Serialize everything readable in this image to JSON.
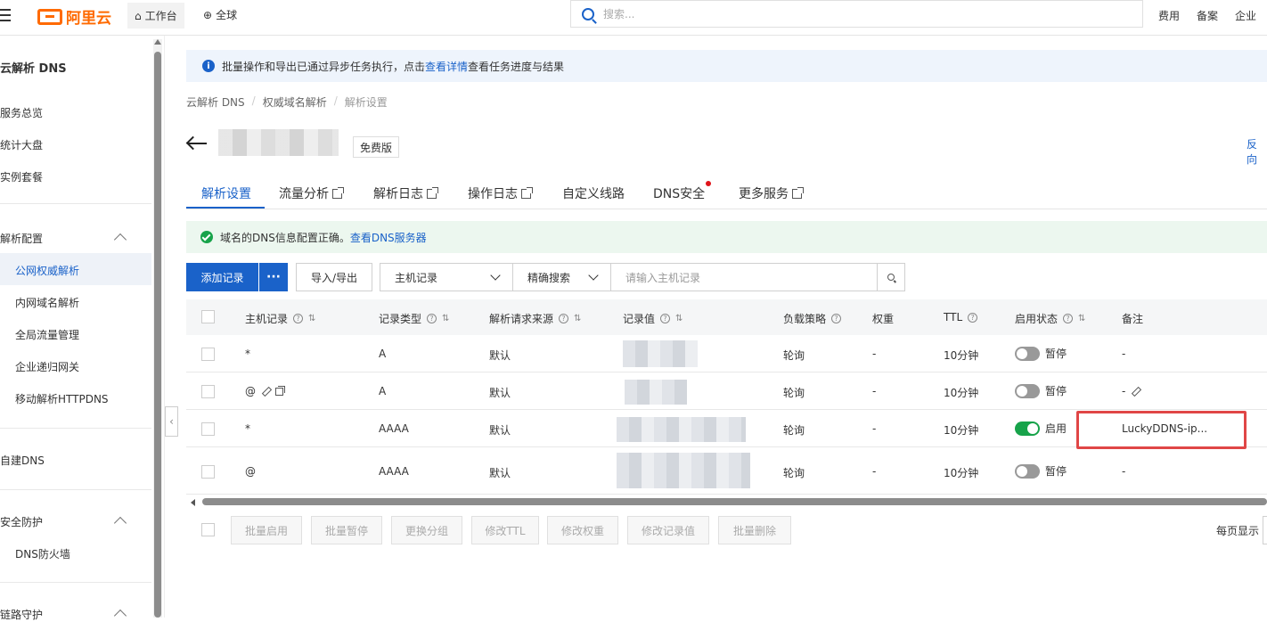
{
  "topbar": {
    "brand": "阿里云",
    "workbench": "工作台",
    "global": "全球",
    "search_placeholder": "搜索...",
    "right_links": [
      "费用",
      "备案",
      "企业"
    ]
  },
  "sidebar": {
    "title": "云解析 DNS",
    "items": [
      {
        "label": "服务总览"
      },
      {
        "label": "统计大盘"
      },
      {
        "label": "实例套餐"
      }
    ],
    "group_resolve": "解析配置",
    "resolve_items": [
      "公网权威解析",
      "内网域名解析",
      "全局流量管理",
      "企业递归网关",
      "移动解析HTTPDNS"
    ],
    "selfbuilt": "自建DNS",
    "group_security": "安全防护",
    "security_items": [
      "DNS防火墙"
    ],
    "group_link": "链路守护"
  },
  "info_bar": {
    "text_before": "批量操作和导出已通过异步任务执行，点击",
    "link": "查看详情",
    "text_after": "查看任务进度与结果"
  },
  "breadcrumb": [
    "云解析 DNS",
    "权威域名解析",
    "解析设置"
  ],
  "header": {
    "badge": "免费版",
    "right_link": "反向"
  },
  "tabs": [
    {
      "label": "解析设置",
      "active": true,
      "external": false
    },
    {
      "label": "流量分析",
      "active": false,
      "external": true
    },
    {
      "label": "解析日志",
      "active": false,
      "external": true
    },
    {
      "label": "操作日志",
      "active": false,
      "external": true
    },
    {
      "label": "自定义线路",
      "active": false,
      "external": false
    },
    {
      "label": "DNS安全",
      "active": false,
      "external": false,
      "dot": true
    },
    {
      "label": "更多服务",
      "active": false,
      "external": true
    }
  ],
  "success_bar": {
    "text": "域名的DNS信息配置正确。",
    "link": "查看DNS服务器"
  },
  "toolbar": {
    "add": "添加记录",
    "more": "···",
    "import_export": "导入/导出",
    "select_field": "主机记录",
    "select_mode": "精确搜索",
    "filter_placeholder": "请输入主机记录"
  },
  "table": {
    "headers": [
      "主机记录",
      "记录类型",
      "解析请求来源",
      "记录值",
      "负载策略",
      "权重",
      "TTL",
      "启用状态",
      "备注"
    ],
    "rows": [
      {
        "host": "*",
        "type": "A",
        "source": "默认",
        "policy": "轮询",
        "weight": "-",
        "ttl": "10分钟",
        "status": "暂停",
        "enabled": false,
        "note": "-"
      },
      {
        "host": "@",
        "type": "A",
        "source": "默认",
        "policy": "轮询",
        "weight": "-",
        "ttl": "10分钟",
        "status": "暂停",
        "enabled": false,
        "note": "-"
      },
      {
        "host": "*",
        "type": "AAAA",
        "source": "默认",
        "policy": "轮询",
        "weight": "-",
        "ttl": "10分钟",
        "status": "启用",
        "enabled": true,
        "note": "LuckyDDNS-ip..."
      },
      {
        "host": "@",
        "type": "AAAA",
        "source": "默认",
        "policy": "轮询",
        "weight": "-",
        "ttl": "10分钟",
        "status": "暂停",
        "enabled": false,
        "note": "-"
      }
    ]
  },
  "batch": [
    "批量启用",
    "批量暂停",
    "更换分组",
    "修改TTL",
    "修改权重",
    "修改记录值",
    "批量删除"
  ],
  "pagination": {
    "label": "每页显示"
  },
  "colors": {
    "primary": "#1a62c9",
    "brand": "#ff6a00",
    "success": "#17a34a",
    "highlight": "#e04646"
  }
}
